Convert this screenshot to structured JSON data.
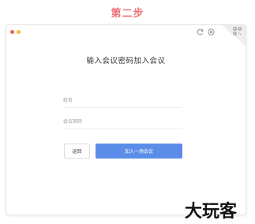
{
  "caption": "第二步",
  "window": {
    "heading": "输入会议密码加入会议",
    "titlebar_icons": [
      "refresh-icon",
      "settings-icon",
      "qr-code-icon"
    ]
  },
  "form": {
    "name_placeholder": "姓名",
    "name_value": "",
    "password_placeholder": "会议密码",
    "password_value": ""
  },
  "buttons": {
    "back_label": "返回",
    "join_label": "加入一场会议"
  },
  "watermark": "大玩客",
  "colors": {
    "caption": "#f07275",
    "primary": "#5b8de8",
    "traffic_red": "#f25c55",
    "traffic_yellow": "#f5b92e"
  }
}
